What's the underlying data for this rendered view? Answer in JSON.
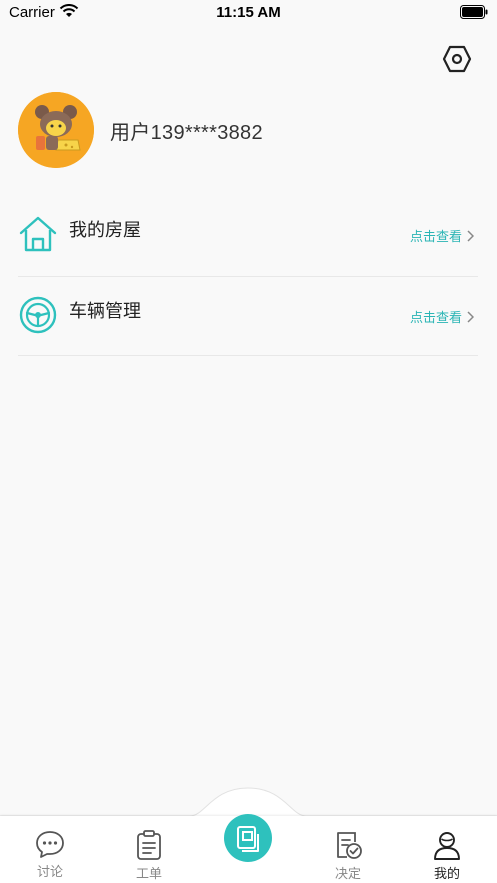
{
  "status_bar": {
    "carrier": "Carrier",
    "time": "11:15 AM"
  },
  "profile": {
    "username": "用户139****3882"
  },
  "menu": {
    "items": [
      {
        "label": "我的房屋",
        "action": "点击查看",
        "icon": "house-icon"
      },
      {
        "label": "车辆管理",
        "action": "点击查看",
        "icon": "steering-wheel-icon"
      }
    ]
  },
  "tabs": [
    {
      "label": "讨论",
      "icon": "chat-bubble-icon"
    },
    {
      "label": "工单",
      "icon": "clipboard-icon"
    },
    {
      "label": "",
      "icon": "center-action-icon"
    },
    {
      "label": "决定",
      "icon": "document-check-icon"
    },
    {
      "label": "我的",
      "icon": "user-icon",
      "active": true
    }
  ],
  "colors": {
    "accent": "#2ec1bd",
    "action_text": "#2bb5b5",
    "avatar_bg": "#f6a623",
    "background": "#f9f9f9"
  }
}
